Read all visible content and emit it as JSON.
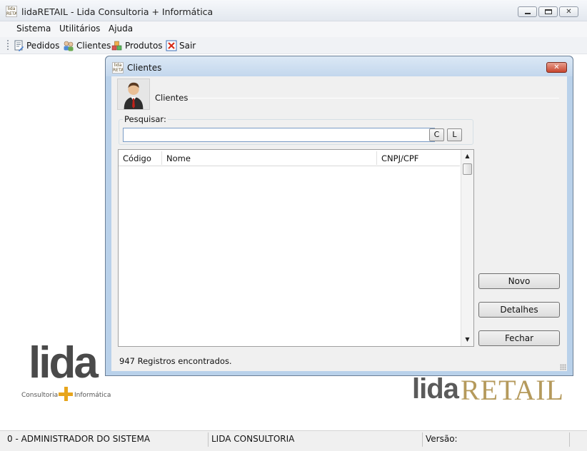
{
  "window": {
    "icon_text": "lida RETAIL",
    "title": "lidaRETAIL - Lida Consultoria + Informática"
  },
  "menu": {
    "items": [
      "Sistema",
      "Utilitários",
      "Ajuda"
    ]
  },
  "toolbar": {
    "items": [
      {
        "label": "Pedidos",
        "icon": "orders-icon"
      },
      {
        "label": "Clientes",
        "icon": "clients-icon"
      },
      {
        "label": "Produtos",
        "icon": "products-icon"
      },
      {
        "label": "Sair",
        "icon": "exit-icon"
      }
    ]
  },
  "dialog": {
    "title": "Clientes",
    "section_label": "Clientes",
    "search": {
      "label": "Pesquisar:",
      "value": "",
      "btn_c": "C",
      "btn_l": "L"
    },
    "grid": {
      "columns": [
        "Código",
        "Nome",
        "CNPJ/CPF"
      ],
      "rows": []
    },
    "buttons": {
      "novo": "Novo",
      "detalhes": "Detalhes",
      "fechar": "Fechar"
    },
    "records_text": "947 Registros encontrados."
  },
  "branding": {
    "lida_logo": "lida",
    "lida_sub_left": "Consultoria",
    "lida_sub_right": "Informática",
    "retail_lida": "lida",
    "retail_word": "RETAIL"
  },
  "status": {
    "user": "0 - ADMINISTRADOR DO SISTEMA",
    "company": "LIDA CONSULTORIA",
    "version_label": "Versão:"
  },
  "colors": {
    "accent_gold": "#b59a5c",
    "plus_orange": "#e7a51c",
    "dialog_frame": "#b9d1ea"
  }
}
